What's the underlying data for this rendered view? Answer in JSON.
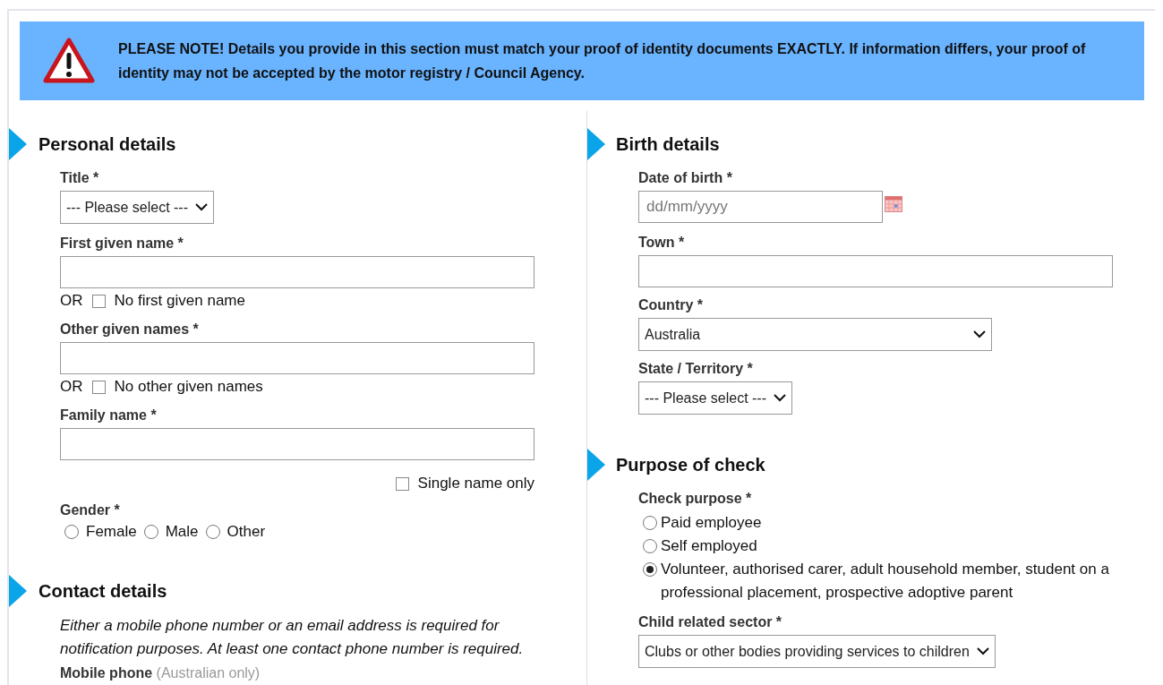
{
  "notice": "PLEASE NOTE! Details you provide in this section must match your proof of identity documents EXACTLY. If information differs, your proof of identity may not be accepted by the motor registry / Council Agency.",
  "columns": [
    {
      "sections": [
        {
          "heading": "Personal details",
          "fields": [
            {
              "kind": "select",
              "label": "Title *",
              "value": "--- Please select ---"
            },
            {
              "kind": "text",
              "label": "First given name *"
            },
            {
              "kind": "or-checkbox",
              "or": "OR",
              "label": "No first given name",
              "checked": false
            },
            {
              "kind": "text",
              "label": "Other given names *"
            },
            {
              "kind": "or-checkbox",
              "or": "OR",
              "label": "No other given names",
              "checked": false
            },
            {
              "kind": "text",
              "label": "Family name *"
            },
            {
              "kind": "checkbox-right",
              "label": "Single name only",
              "checked": false
            },
            {
              "kind": "radios-inline",
              "label": "Gender *",
              "options": [
                {
                  "label": "Female",
                  "selected": false
                },
                {
                  "label": "Male",
                  "selected": false
                },
                {
                  "label": "Other",
                  "selected": false
                }
              ]
            }
          ]
        },
        {
          "heading": "Contact details",
          "fields": [
            {
              "kind": "note",
              "text": "Either a mobile phone number or an email address is required for notification purposes. At least one contact phone number is required."
            },
            {
              "kind": "label",
              "label": "Mobile phone",
              "hint": "(Australian only)"
            }
          ]
        }
      ]
    },
    {
      "sections": [
        {
          "heading": "Birth details",
          "fields": [
            {
              "kind": "date",
              "label": "Date of birth *",
              "placeholder": "dd/mm/yyyy"
            },
            {
              "kind": "text",
              "label": "Town *"
            },
            {
              "kind": "select-wide",
              "label": "Country *",
              "value": "Australia"
            },
            {
              "kind": "select",
              "label": "State / Territory *",
              "value": "--- Please select ---"
            }
          ]
        },
        {
          "heading": "Purpose of check",
          "fields": [
            {
              "kind": "radios-stacked",
              "label": "Check purpose *",
              "options": [
                {
                  "label": "Paid employee",
                  "selected": false
                },
                {
                  "label": "Self employed",
                  "selected": false
                },
                {
                  "label": "Volunteer, authorised carer, adult household member, student on a professional placement, prospective adoptive parent",
                  "selected": true
                }
              ]
            },
            {
              "kind": "select",
              "label": "Child related sector *",
              "value": "Clubs or other bodies providing services to children"
            }
          ]
        }
      ]
    }
  ]
}
